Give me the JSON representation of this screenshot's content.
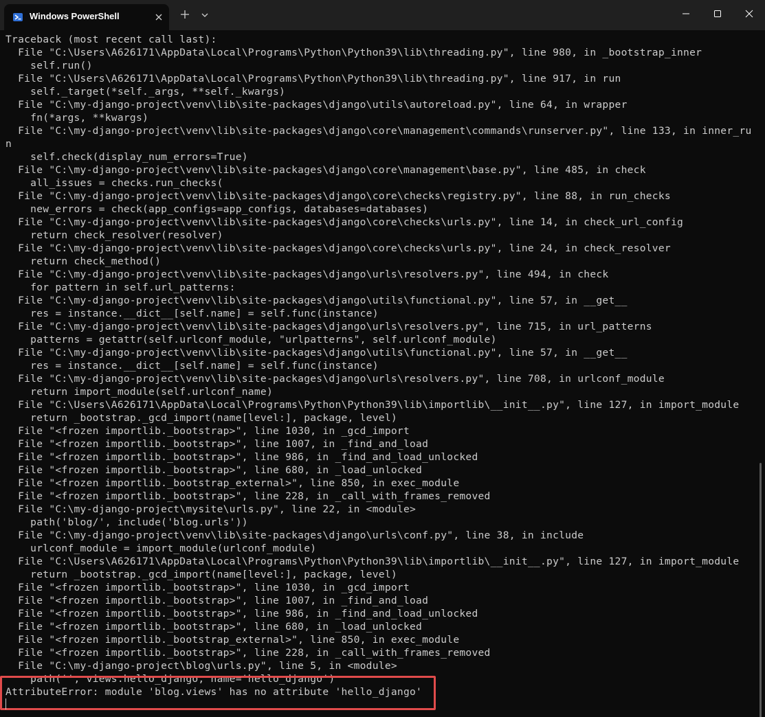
{
  "window": {
    "tab_title": "Windows PowerShell",
    "icons": [
      "powershell-icon",
      "close-icon",
      "plus-icon",
      "chevron-down-icon",
      "minimize-icon",
      "maximize-icon",
      "close-icon"
    ]
  },
  "terminal": {
    "lines": [
      "Traceback (most recent call last):",
      "  File \"C:\\Users\\A626171\\AppData\\Local\\Programs\\Python\\Python39\\lib\\threading.py\", line 980, in _bootstrap_inner",
      "    self.run()",
      "  File \"C:\\Users\\A626171\\AppData\\Local\\Programs\\Python\\Python39\\lib\\threading.py\", line 917, in run",
      "    self._target(*self._args, **self._kwargs)",
      "  File \"C:\\my-django-project\\venv\\lib\\site-packages\\django\\utils\\autoreload.py\", line 64, in wrapper",
      "    fn(*args, **kwargs)",
      "  File \"C:\\my-django-project\\venv\\lib\\site-packages\\django\\core\\management\\commands\\runserver.py\", line 133, in inner_ru",
      "n",
      "    self.check(display_num_errors=True)",
      "  File \"C:\\my-django-project\\venv\\lib\\site-packages\\django\\core\\management\\base.py\", line 485, in check",
      "    all_issues = checks.run_checks(",
      "  File \"C:\\my-django-project\\venv\\lib\\site-packages\\django\\core\\checks\\registry.py\", line 88, in run_checks",
      "    new_errors = check(app_configs=app_configs, databases=databases)",
      "  File \"C:\\my-django-project\\venv\\lib\\site-packages\\django\\core\\checks\\urls.py\", line 14, in check_url_config",
      "    return check_resolver(resolver)",
      "  File \"C:\\my-django-project\\venv\\lib\\site-packages\\django\\core\\checks\\urls.py\", line 24, in check_resolver",
      "    return check_method()",
      "  File \"C:\\my-django-project\\venv\\lib\\site-packages\\django\\urls\\resolvers.py\", line 494, in check",
      "    for pattern in self.url_patterns:",
      "  File \"C:\\my-django-project\\venv\\lib\\site-packages\\django\\utils\\functional.py\", line 57, in __get__",
      "    res = instance.__dict__[self.name] = self.func(instance)",
      "  File \"C:\\my-django-project\\venv\\lib\\site-packages\\django\\urls\\resolvers.py\", line 715, in url_patterns",
      "    patterns = getattr(self.urlconf_module, \"urlpatterns\", self.urlconf_module)",
      "  File \"C:\\my-django-project\\venv\\lib\\site-packages\\django\\utils\\functional.py\", line 57, in __get__",
      "    res = instance.__dict__[self.name] = self.func(instance)",
      "  File \"C:\\my-django-project\\venv\\lib\\site-packages\\django\\urls\\resolvers.py\", line 708, in urlconf_module",
      "    return import_module(self.urlconf_name)",
      "  File \"C:\\Users\\A626171\\AppData\\Local\\Programs\\Python\\Python39\\lib\\importlib\\__init__.py\", line 127, in import_module",
      "    return _bootstrap._gcd_import(name[level:], package, level)",
      "  File \"<frozen importlib._bootstrap>\", line 1030, in _gcd_import",
      "  File \"<frozen importlib._bootstrap>\", line 1007, in _find_and_load",
      "  File \"<frozen importlib._bootstrap>\", line 986, in _find_and_load_unlocked",
      "  File \"<frozen importlib._bootstrap>\", line 680, in _load_unlocked",
      "  File \"<frozen importlib._bootstrap_external>\", line 850, in exec_module",
      "  File \"<frozen importlib._bootstrap>\", line 228, in _call_with_frames_removed",
      "  File \"C:\\my-django-project\\mysite\\urls.py\", line 22, in <module>",
      "    path('blog/', include('blog.urls'))",
      "  File \"C:\\my-django-project\\venv\\lib\\site-packages\\django\\urls\\conf.py\", line 38, in include",
      "    urlconf_module = import_module(urlconf_module)",
      "  File \"C:\\Users\\A626171\\AppData\\Local\\Programs\\Python\\Python39\\lib\\importlib\\__init__.py\", line 127, in import_module",
      "    return _bootstrap._gcd_import(name[level:], package, level)",
      "  File \"<frozen importlib._bootstrap>\", line 1030, in _gcd_import",
      "  File \"<frozen importlib._bootstrap>\", line 1007, in _find_and_load",
      "  File \"<frozen importlib._bootstrap>\", line 986, in _find_and_load_unlocked",
      "  File \"<frozen importlib._bootstrap>\", line 680, in _load_unlocked",
      "  File \"<frozen importlib._bootstrap_external>\", line 850, in exec_module",
      "  File \"<frozen importlib._bootstrap>\", line 228, in _call_with_frames_removed",
      "  File \"C:\\my-django-project\\blog\\urls.py\", line 5, in <module>",
      "    path('', views.hello_django, name='hello_django')",
      "AttributeError: module 'blog.views' has no attribute 'hello_django'"
    ]
  },
  "colors": {
    "background": "#0c0c0c",
    "titlebar": "#202020",
    "text": "#cccccc",
    "highlight_border": "#e04b4b"
  }
}
